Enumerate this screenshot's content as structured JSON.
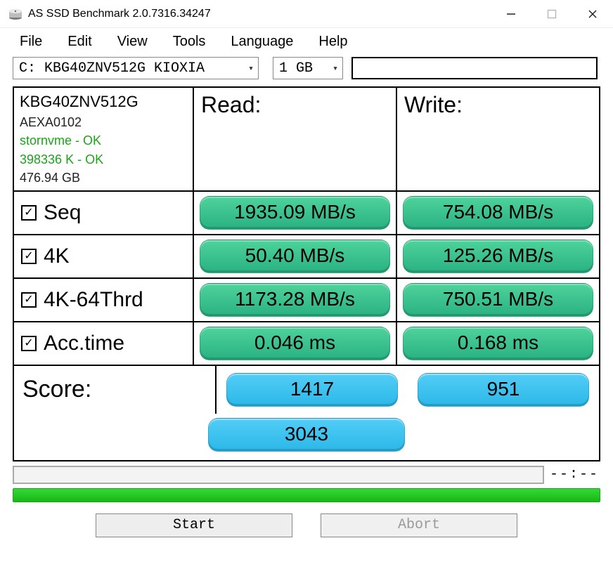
{
  "window": {
    "title": "AS SSD Benchmark 2.0.7316.34247"
  },
  "menu": {
    "file": "File",
    "edit": "Edit",
    "view": "View",
    "tools": "Tools",
    "language": "Language",
    "help": "Help"
  },
  "toolbar": {
    "drive_selected": "C: KBG40ZNV512G KIOXIA",
    "size_selected": "1 GB"
  },
  "device": {
    "model": "KBG40ZNV512G",
    "fw": "AEXA0102",
    "driver": "stornvme - OK",
    "alignment": "398336 K - OK",
    "capacity": "476.94 GB"
  },
  "headers": {
    "read": "Read:",
    "write": "Write:"
  },
  "tests": {
    "seq": {
      "label": "Seq",
      "read": "1935.09 MB/s",
      "write": "754.08 MB/s"
    },
    "fourk": {
      "label": "4K",
      "read": "50.40 MB/s",
      "write": "125.26 MB/s"
    },
    "fourk64": {
      "label": "4K-64Thrd",
      "read": "1173.28 MB/s",
      "write": "750.51 MB/s"
    },
    "acc": {
      "label": "Acc.time",
      "read": "0.046 ms",
      "write": "0.168 ms"
    }
  },
  "score": {
    "label": "Score:",
    "read": "1417",
    "write": "951",
    "total": "3043"
  },
  "status": {
    "time": "--:--"
  },
  "buttons": {
    "start": "Start",
    "abort": "Abort"
  }
}
